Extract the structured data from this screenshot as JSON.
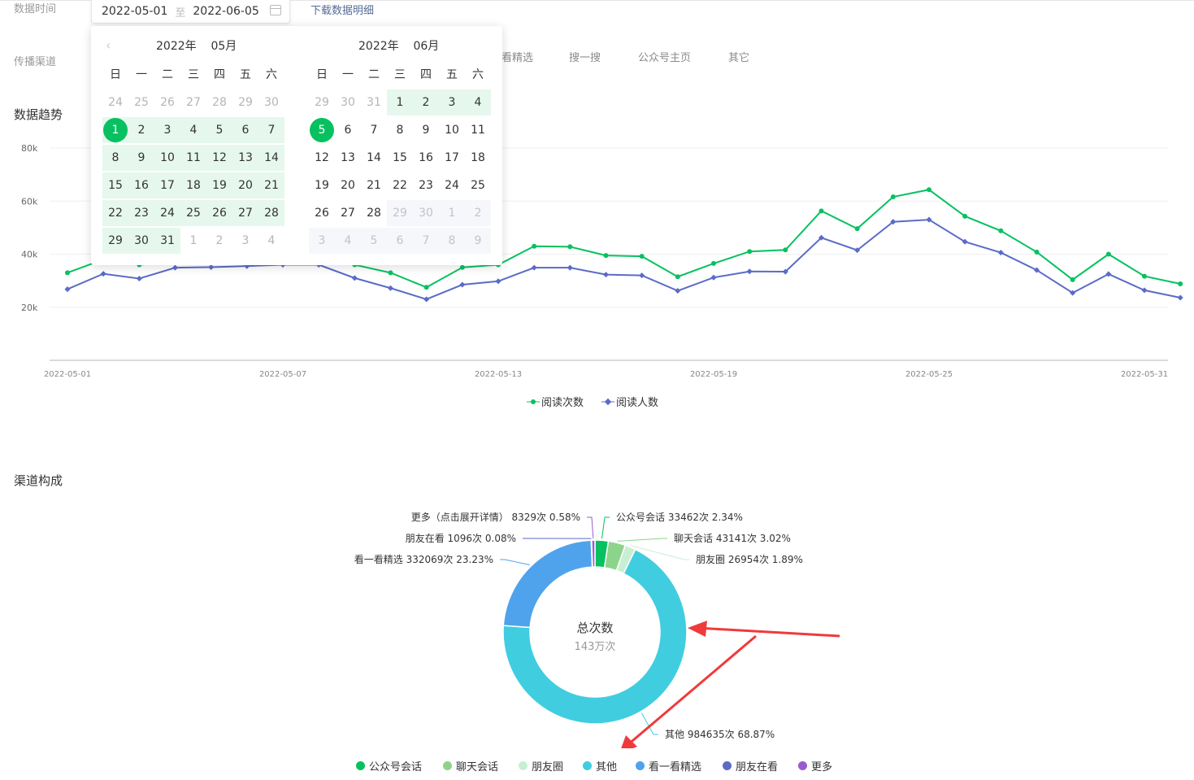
{
  "filters": {
    "date_label": "数据时间",
    "start_date": "2022-05-01",
    "range_sep": "至",
    "end_date": "2022-06-05",
    "download_link": "下载数据明细",
    "channel_label": "传播渠道",
    "channel_tabs": [
      "看精选",
      "搜一搜",
      "公众号主页",
      "其它"
    ]
  },
  "calendar": {
    "weekdays": [
      "日",
      "一",
      "二",
      "三",
      "四",
      "五",
      "六"
    ],
    "left": {
      "year": "2022年",
      "month": "05月",
      "days": [
        "24",
        "25",
        "26",
        "27",
        "28",
        "29",
        "30",
        "1",
        "2",
        "3",
        "4",
        "5",
        "6",
        "7",
        "8",
        "9",
        "10",
        "11",
        "12",
        "13",
        "14",
        "15",
        "16",
        "17",
        "18",
        "19",
        "20",
        "21",
        "22",
        "23",
        "24",
        "25",
        "26",
        "27",
        "28",
        "29",
        "30",
        "31",
        "1",
        "2",
        "3",
        "4"
      ]
    },
    "right": {
      "year": "2022年",
      "month": "06月",
      "days": [
        "29",
        "30",
        "31",
        "1",
        "2",
        "3",
        "4",
        "5",
        "6",
        "7",
        "8",
        "9",
        "10",
        "11",
        "12",
        "13",
        "14",
        "15",
        "16",
        "17",
        "18",
        "19",
        "20",
        "21",
        "22",
        "23",
        "24",
        "25",
        "26",
        "27",
        "28",
        "29",
        "30",
        "1",
        "2",
        "3",
        "4",
        "5",
        "6",
        "7",
        "8",
        "9"
      ]
    }
  },
  "trend": {
    "title": "数据趋势"
  },
  "chart_data": [
    {
      "type": "line",
      "y_ticks": [
        "20k",
        "40k",
        "60k",
        "80k"
      ],
      "ylim": [
        0,
        80000
      ],
      "x_ticks": [
        "2022-05-01",
        "2022-05-07",
        "2022-05-13",
        "2022-05-19",
        "2022-05-25",
        "2022-05-31"
      ],
      "x": [
        "2022-05-01",
        "2022-05-02",
        "2022-05-03",
        "2022-05-04",
        "2022-05-05",
        "2022-05-06",
        "2022-05-07",
        "2022-05-08",
        "2022-05-09",
        "2022-05-10",
        "2022-05-11",
        "2022-05-12",
        "2022-05-13",
        "2022-05-14",
        "2022-05-15",
        "2022-05-16",
        "2022-05-17",
        "2022-05-18",
        "2022-05-19",
        "2022-05-20",
        "2022-05-21",
        "2022-05-22",
        "2022-05-23",
        "2022-05-24",
        "2022-05-25",
        "2022-05-26",
        "2022-05-27",
        "2022-05-28",
        "2022-05-29",
        "2022-05-30",
        "2022-05-31",
        "2022-06-01"
      ],
      "series": [
        {
          "name": "阅读次数",
          "color": "#07c160",
          "values": [
            33000,
            38000,
            36000,
            37000,
            37000,
            37500,
            38000,
            38000,
            36000,
            33000,
            27500,
            35000,
            36000,
            43000,
            42800,
            39500,
            39200,
            31500,
            36500,
            41000,
            41600,
            56300,
            49600,
            61600,
            64300,
            54300,
            48800,
            40800,
            30400,
            40000,
            31700,
            28800
          ]
        },
        {
          "name": "阅读人数",
          "color": "#5b6bc7",
          "values": [
            26800,
            32600,
            30800,
            34900,
            35100,
            35500,
            36000,
            36000,
            31000,
            27200,
            23000,
            28500,
            29800,
            34900,
            34900,
            32300,
            32000,
            26200,
            31200,
            33500,
            33400,
            46200,
            41500,
            52200,
            53000,
            44700,
            40600,
            34000,
            25400,
            32500,
            26400,
            23600
          ]
        }
      ]
    },
    {
      "type": "pie",
      "title": "渠道构成",
      "center_title": "总次数",
      "center_value": "143万次",
      "slices": [
        {
          "name": "公众号会话",
          "value": 33462,
          "percent": "2.34%",
          "label": "公众号会话 33462次 2.34%",
          "color": "#07c160"
        },
        {
          "name": "聊天会话",
          "value": 43141,
          "percent": "3.02%",
          "label": "聊天会话 43141次 3.02%",
          "color": "#8cd48a"
        },
        {
          "name": "朋友圈",
          "value": 26954,
          "percent": "1.89%",
          "label": "朋友圈 26954次 1.89%",
          "color": "#c8efd3"
        },
        {
          "name": "其他",
          "value": 984635,
          "percent": "68.87%",
          "label": "其他 984635次 68.87%",
          "color": "#40cde0"
        },
        {
          "name": "看一看精选",
          "value": 332069,
          "percent": "23.23%",
          "label": "看一看精选 332069次 23.23%",
          "color": "#4fa3ec"
        },
        {
          "name": "朋友在看",
          "value": 1096,
          "percent": "0.08%",
          "label": "朋友在看 1096次 0.08%",
          "color": "#5b6bc7"
        },
        {
          "name": "更多",
          "value": 8329,
          "percent": "0.58%",
          "label": "更多（点击展开详情） 8329次 0.58%",
          "color": "#9b59d0"
        }
      ]
    }
  ]
}
